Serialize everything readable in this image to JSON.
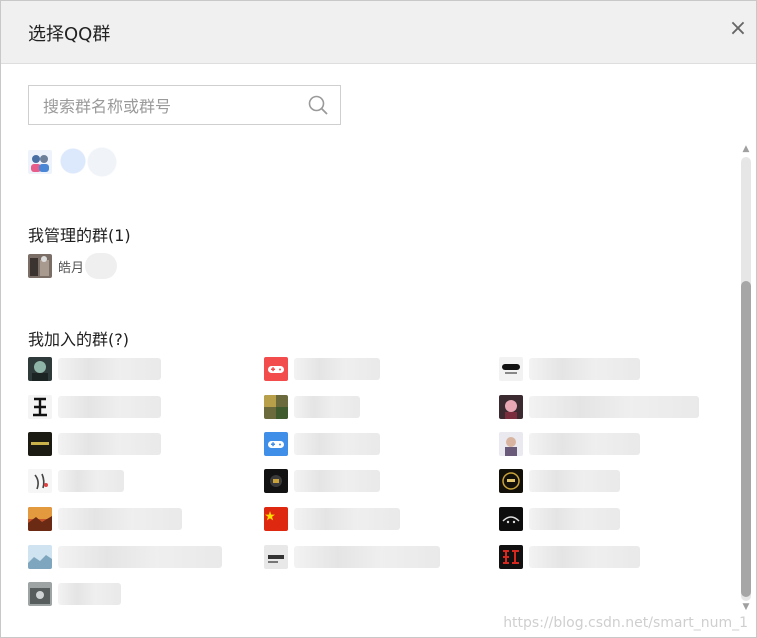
{
  "dialog": {
    "title": "选择QQ群",
    "close_symbol": "×"
  },
  "search": {
    "placeholder": "搜索群名称或群号",
    "icon": "search-icon"
  },
  "sections": {
    "managed_title": "我管理的群(1)",
    "joined_title": "我加入的群(?)"
  },
  "managed_groups": [
    {
      "name": "皓月"
    }
  ],
  "watermark": "https://blog.csdn.net/smart_num_1",
  "colors": {
    "title_bar_bg": "#f0f0f0",
    "border": "#c8c8c8",
    "scroll_thumb": "#a6a6a6",
    "text_primary": "#1f1f1f",
    "text_secondary": "#555555"
  }
}
